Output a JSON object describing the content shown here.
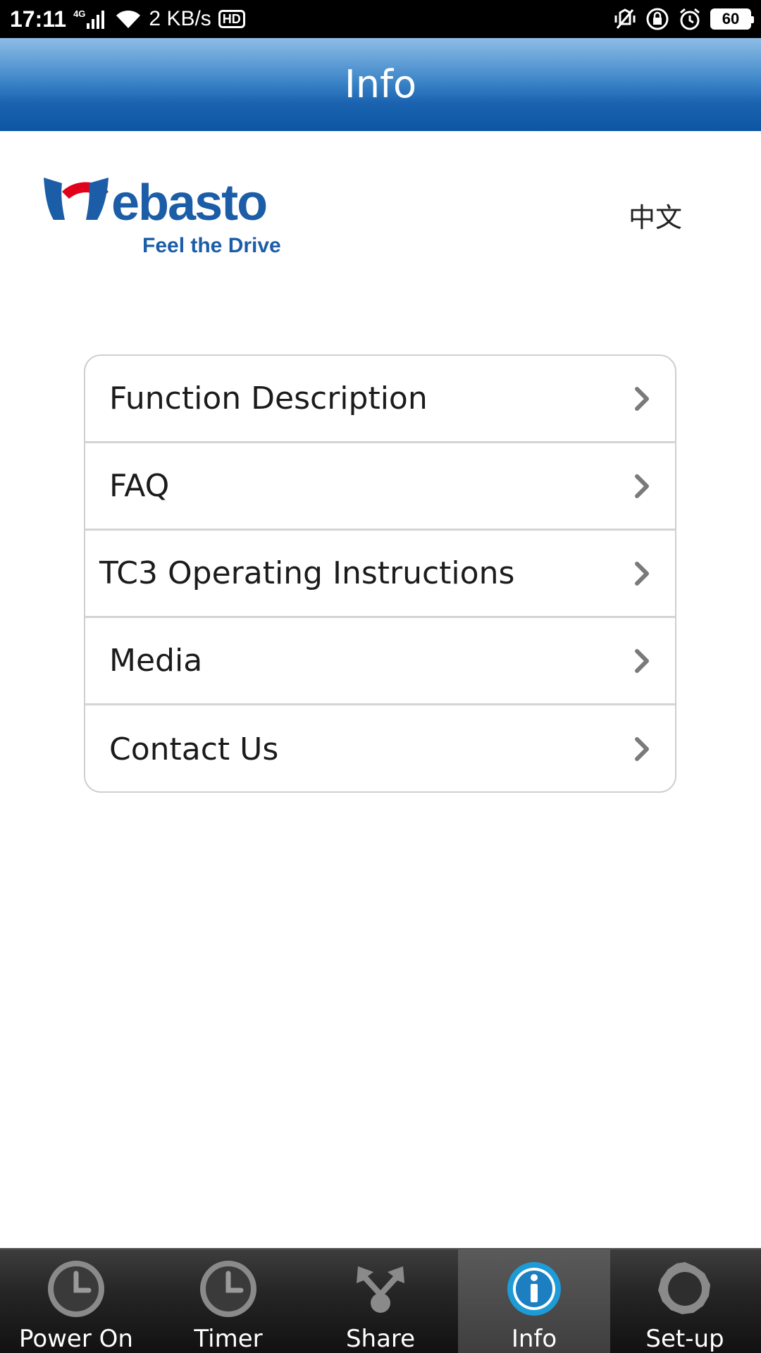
{
  "status_bar": {
    "time": "17:11",
    "network": "4G",
    "speed": "2 KB/s",
    "hd": "HD",
    "battery": "60"
  },
  "header": {
    "title": "Info"
  },
  "logo": {
    "brand": "Webasto",
    "tagline": "Feel the Drive",
    "colors": {
      "red": "#e2001a",
      "blue": "#1c5da8"
    }
  },
  "language_button": "中文",
  "menu": {
    "items": [
      {
        "label": "Function Description"
      },
      {
        "label": "FAQ"
      },
      {
        "label": "TC3 Operating Instructions"
      },
      {
        "label": "Media"
      },
      {
        "label": "Contact Us"
      }
    ]
  },
  "tabs": [
    {
      "label": "Power On",
      "icon": "clock-icon"
    },
    {
      "label": "Timer",
      "icon": "timer-icon"
    },
    {
      "label": "Share",
      "icon": "share-icon"
    },
    {
      "label": "Info",
      "icon": "info-icon",
      "active": true
    },
    {
      "label": "Set-up",
      "icon": "gear-icon"
    }
  ],
  "colors": {
    "header_blue": "#1b63b0",
    "active_tab": "#4a4a4a",
    "info_icon_blue": "#1e9bd7"
  }
}
